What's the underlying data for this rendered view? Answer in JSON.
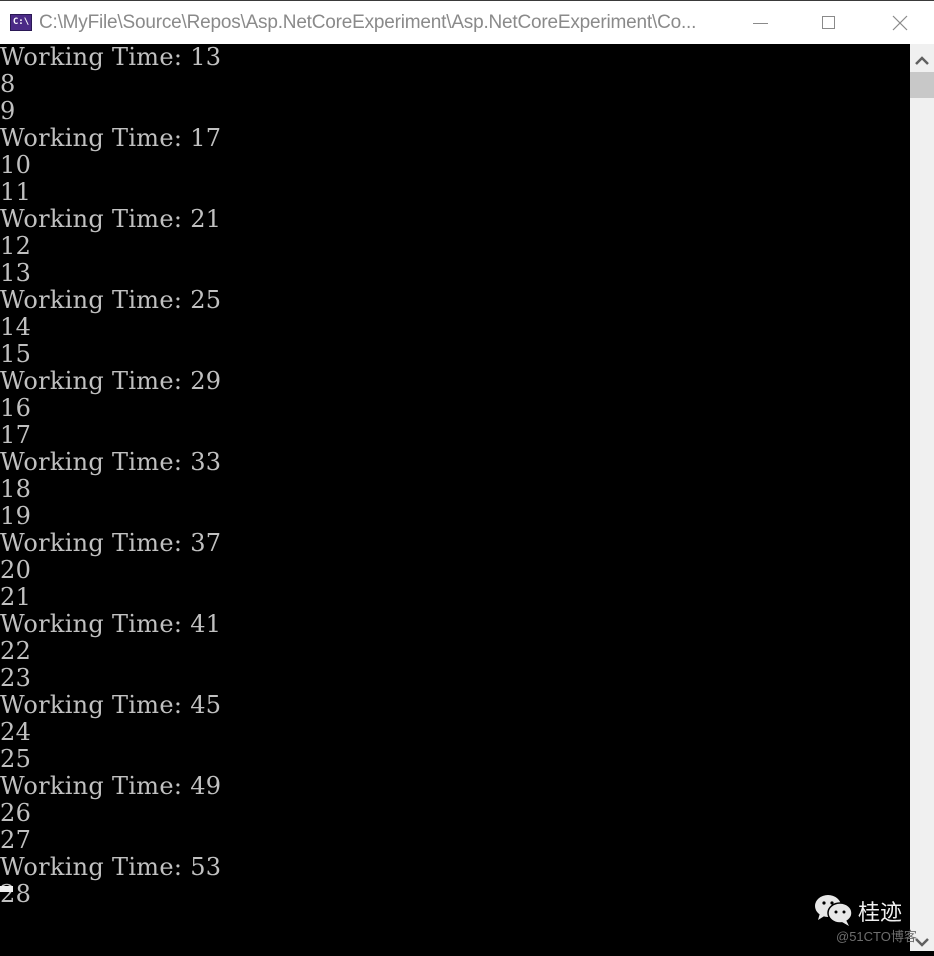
{
  "window": {
    "icon_label": "C:\\",
    "title": "C:\\MyFile\\Source\\Repos\\Asp.NetCoreExperiment\\Asp.NetCoreExperiment\\Co...",
    "buttons": {
      "minimize": "minimize",
      "maximize": "maximize",
      "close": "close"
    }
  },
  "console": {
    "lines": [
      "Working Time: 13",
      "8",
      "9",
      "Working Time: 17",
      "10",
      "11",
      "Working Time: 21",
      "12",
      "13",
      "Working Time: 25",
      "14",
      "15",
      "Working Time: 29",
      "16",
      "17",
      "Working Time: 33",
      "18",
      "19",
      "Working Time: 37",
      "20",
      "21",
      "Working Time: 41",
      "22",
      "23",
      "Working Time: 45",
      "24",
      "25",
      "Working Time: 49",
      "26",
      "27",
      "Working Time: 53",
      "28"
    ]
  },
  "watermark": {
    "name": "桂迹",
    "site": "@51CTO博客"
  }
}
